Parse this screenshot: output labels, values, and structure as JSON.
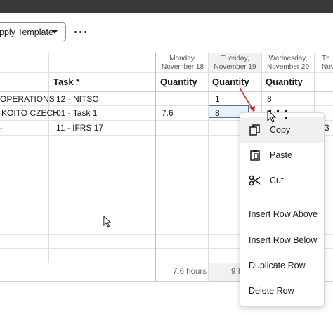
{
  "toolbar": {
    "apply_template_label": "pply Template",
    "more_label": "more"
  },
  "grid": {
    "days": [
      {
        "weekday": "Monday,",
        "date": "November 18"
      },
      {
        "weekday": "Tuesday,",
        "date": "November 19"
      },
      {
        "weekday": "Wednesday,",
        "date": "November 20"
      },
      {
        "weekday": "Th",
        "date": "Nov"
      }
    ],
    "headers": {
      "task": "Task *",
      "quantity": "Quantity"
    },
    "rows": [
      {
        "project": "OPERATIONS",
        "task": "12 - NITSO",
        "mon": "",
        "tue": "1",
        "wed": "8"
      },
      {
        "project": "KOITO CZECH",
        "task": "01 - Task 1",
        "mon": "7.6",
        "tue": "8",
        "wed": ""
      },
      {
        "project": "-",
        "task": "11 - IFRS 17",
        "mon": "",
        "tue": "",
        "wed": ""
      }
    ],
    "row1_overflow": "3",
    "footer": {
      "mon_total": "7.6 hours",
      "tue_total": "9 I"
    }
  },
  "context_menu": {
    "copy": "Copy",
    "paste": "Paste",
    "cut": "Cut",
    "insert_above": "Insert Row Above",
    "insert_below": "Insert Row Below",
    "duplicate": "Duplicate Row",
    "delete": "Delete Row"
  },
  "colors": {
    "topbar": "#3a3838",
    "selection_border": "#2b7fc4",
    "annotation_arrow": "#d62828",
    "link": "#1f6fb4"
  }
}
